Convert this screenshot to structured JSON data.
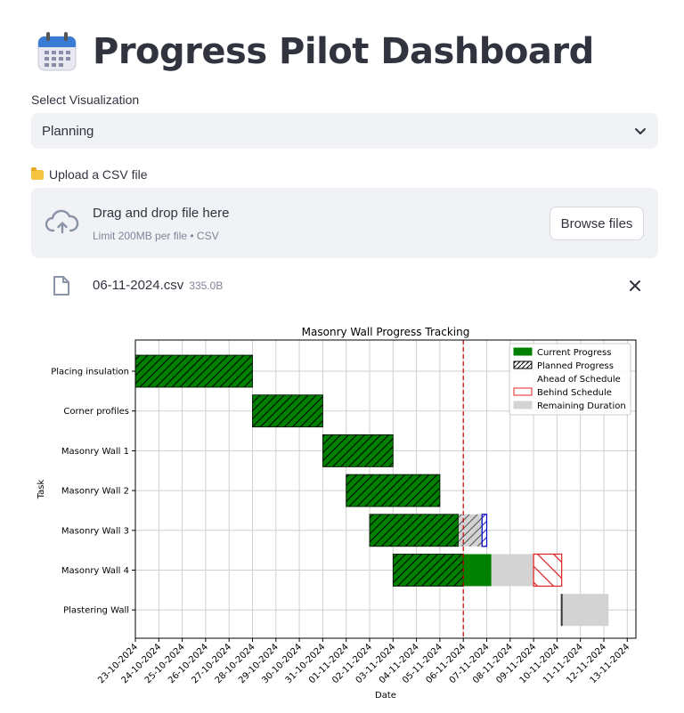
{
  "header": {
    "title": "Progress Pilot Dashboard",
    "icon": "calendar-icon"
  },
  "visualization_select": {
    "label": "Select Visualization",
    "selected": "Planning"
  },
  "uploader": {
    "label": "Upload a CSV file",
    "label_icon": "folder-icon",
    "dropzone_title": "Drag and drop file here",
    "dropzone_limit": "Limit 200MB per file • CSV",
    "browse_label": "Browse files",
    "file": {
      "name": "06-11-2024.csv",
      "size": "335.0B"
    }
  },
  "colors": {
    "current": "#008000",
    "planned_edge": "#0000cc",
    "behind": "#e02020",
    "remaining": "#d3d3d3",
    "today_line": "#cc0000"
  },
  "chart_data": {
    "type": "gantt",
    "title": "Masonry Wall Progress Tracking",
    "xlabel": "Date",
    "ylabel": "Task",
    "xlim": [
      "2024-10-23",
      "2024-11-13"
    ],
    "grid": true,
    "legend_position": "top-right",
    "today": "2024-11-06",
    "dates": [
      "23-10-2024",
      "24-10-2024",
      "25-10-2024",
      "26-10-2024",
      "27-10-2024",
      "28-10-2024",
      "29-10-2024",
      "30-10-2024",
      "31-10-2024",
      "01-11-2024",
      "02-11-2024",
      "03-11-2024",
      "04-11-2024",
      "05-11-2024",
      "06-11-2024",
      "07-11-2024",
      "08-11-2024",
      "09-11-2024",
      "10-11-2024",
      "11-11-2024",
      "12-11-2024",
      "13-11-2024"
    ],
    "legend": [
      "Current Progress",
      "Planned Progress",
      "Ahead of Schedule",
      "Behind Schedule",
      "Remaining Duration"
    ],
    "tasks": [
      {
        "name": "Placing insulation",
        "segments": [
          {
            "kind": "planned_done",
            "start": "2024-10-23",
            "end": "2024-10-28"
          }
        ]
      },
      {
        "name": "Corner profiles",
        "segments": [
          {
            "kind": "planned_done",
            "start": "2024-10-28",
            "end": "2024-10-31"
          }
        ]
      },
      {
        "name": "Masonry Wall 1",
        "segments": [
          {
            "kind": "planned_done",
            "start": "2024-10-31",
            "end": "2024-11-03"
          }
        ]
      },
      {
        "name": "Masonry Wall 2",
        "segments": [
          {
            "kind": "planned_done",
            "start": "2024-11-01",
            "end": "2024-11-05"
          }
        ]
      },
      {
        "name": "Masonry Wall 3",
        "segments": [
          {
            "kind": "planned_done",
            "start": "2024-11-02",
            "end": "2024-11-05.8"
          },
          {
            "kind": "remaining",
            "start": "2024-11-05.8",
            "end": "2024-11-06.8"
          },
          {
            "kind": "planned_hatch",
            "start": "2024-11-05.8",
            "end": "2024-11-07"
          },
          {
            "kind": "planned_edge",
            "start": "2024-11-06.8",
            "end": "2024-11-07"
          }
        ]
      },
      {
        "name": "Masonry Wall 4",
        "segments": [
          {
            "kind": "planned_done",
            "start": "2024-11-03",
            "end": "2024-11-06"
          },
          {
            "kind": "current",
            "start": "2024-11-06",
            "end": "2024-11-07.2"
          },
          {
            "kind": "remaining",
            "start": "2024-11-07.2",
            "end": "2024-11-09"
          },
          {
            "kind": "behind",
            "start": "2024-11-09",
            "end": "2024-11-10.2"
          }
        ]
      },
      {
        "name": "Plastering Wall",
        "segments": [
          {
            "kind": "remaining",
            "start": "2024-11-10.2",
            "end": "2024-11-12.2"
          },
          {
            "kind": "start_marker",
            "start": "2024-11-10.2",
            "end": "2024-11-10.2"
          }
        ]
      }
    ]
  }
}
